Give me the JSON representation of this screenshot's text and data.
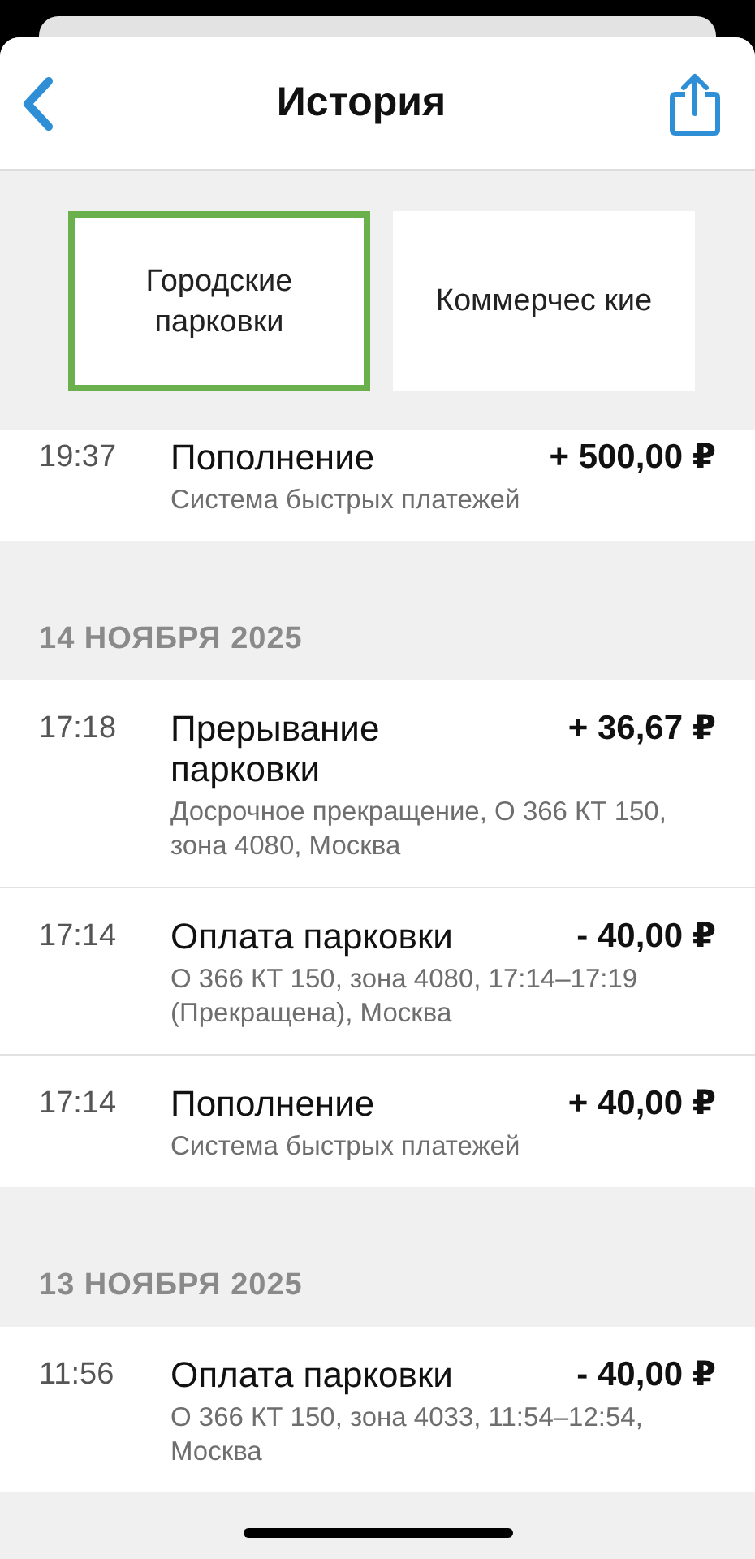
{
  "header": {
    "title": "История"
  },
  "tabs": [
    {
      "label": "Городские парковки",
      "selected": true
    },
    {
      "label": "Коммерчес кие",
      "selected": false
    }
  ],
  "groups": [
    {
      "items": [
        {
          "time": "19:37",
          "title": "Пополнение",
          "amount": "+ 500,00 ₽",
          "details": "Система быстрых платежей"
        }
      ]
    },
    {
      "date": "14 НОЯБРЯ 2025",
      "items": [
        {
          "time": "17:18",
          "title": "Прерывание парковки",
          "amount": "+ 36,67 ₽",
          "details": "Досрочное прекращение, О 366 КТ 150, зона 4080, Москва"
        },
        {
          "time": "17:14",
          "title": "Оплата парковки",
          "amount": "- 40,00 ₽",
          "details": "О 366 КТ 150, зона 4080, 17:14–17:19 (Прекращена), Москва"
        },
        {
          "time": "17:14",
          "title": "Пополнение",
          "amount": "+ 40,00 ₽",
          "details": "Система быстрых платежей"
        }
      ]
    },
    {
      "date": "13 НОЯБРЯ 2025",
      "items": [
        {
          "time": "11:56",
          "title": "Оплата парковки",
          "amount": "- 40,00 ₽",
          "details": "О 366 КТ 150, зона 4033, 11:54–12:54, Москва"
        }
      ]
    }
  ]
}
